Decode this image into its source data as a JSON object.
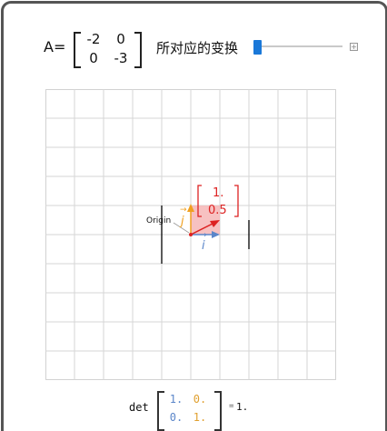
{
  "header": {
    "matrix_label": "A=",
    "matrix": [
      [
        "-2",
        "0"
      ],
      [
        "0",
        "-3"
      ]
    ],
    "caption": "所对应的变换",
    "slider_value": 0
  },
  "plot": {
    "grid": {
      "cols": 10,
      "rows": 10
    },
    "origin_label": "Origin",
    "vector_label": [
      "1.",
      "0.5"
    ],
    "i_hat_label": "i",
    "j_hat_label": "j",
    "colors": {
      "vector": "#dd2222",
      "i_hat": "#5b86c9",
      "j_hat": "#f0a020",
      "fill": "#f6b6b6"
    }
  },
  "determinant": {
    "label": "det",
    "matrix": [
      [
        "1.",
        "0."
      ],
      [
        "0.",
        "1."
      ]
    ],
    "equals": "=",
    "value": "1."
  }
}
